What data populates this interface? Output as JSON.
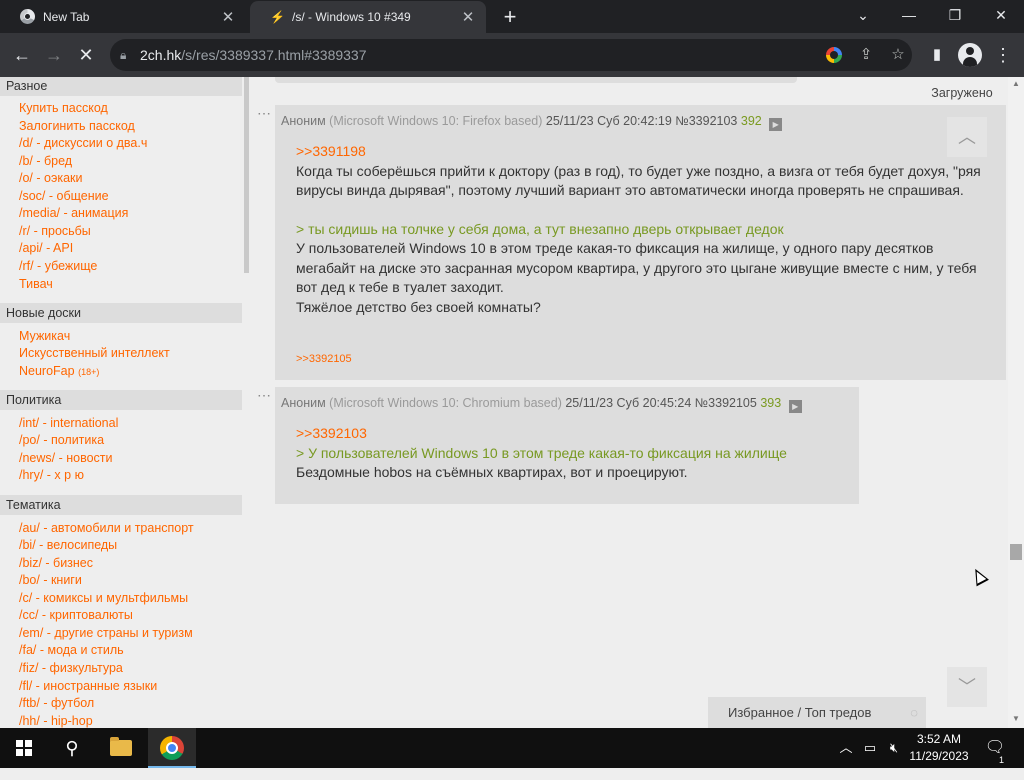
{
  "tabs": [
    {
      "title": "New Tab"
    },
    {
      "title": "/s/ - Windows 10 #349"
    }
  ],
  "address": {
    "host": "2ch.hk",
    "path": "/s/res/3389337.html#3389337"
  },
  "sidebar": {
    "sections": [
      {
        "title": "Разное",
        "links": [
          {
            "label": "Купить пасскод"
          },
          {
            "label": "Залогинить пасскод"
          },
          {
            "label": "/d/ - дискуссии о два.ч"
          },
          {
            "label": "/b/ - бред"
          },
          {
            "label": "/o/ - оэкаки"
          },
          {
            "label": "/soc/ - общение"
          },
          {
            "label": "/media/ - анимация"
          },
          {
            "label": "/r/ - просьбы"
          },
          {
            "label": "/api/ - API"
          },
          {
            "label": "/rf/ - убежище"
          },
          {
            "label": "Тивач"
          }
        ]
      },
      {
        "title": "Новые доски",
        "links": [
          {
            "label": "Мужикач"
          },
          {
            "label": "Искусственный интеллект"
          },
          {
            "label": "NeuroFap",
            "tag": "(18+)"
          }
        ]
      },
      {
        "title": "Политика",
        "links": [
          {
            "label": "/int/ - international"
          },
          {
            "label": "/po/ - политика"
          },
          {
            "label": "/news/ - новости"
          },
          {
            "label": "/hry/ - х р ю"
          }
        ]
      },
      {
        "title": "Тематика",
        "links": [
          {
            "label": "/au/ - автомобили и транспорт"
          },
          {
            "label": "/bi/ - велосипеды"
          },
          {
            "label": "/biz/ - бизнес"
          },
          {
            "label": "/bo/ - книги"
          },
          {
            "label": "/c/ - комиксы и мультфильмы"
          },
          {
            "label": "/cc/ - криптовалюты"
          },
          {
            "label": "/em/ - другие страны и туризм"
          },
          {
            "label": "/fa/ - мода и стиль"
          },
          {
            "label": "/fiz/ - физкультура"
          },
          {
            "label": "/fl/ - иностранные языки"
          },
          {
            "label": "/ftb/ - футбол"
          },
          {
            "label": "/hh/ - hip-hop"
          }
        ]
      }
    ]
  },
  "loaded_label": "Загружено",
  "posts": [
    {
      "name": "Аноним",
      "ua": "(Microsoft Windows 10: Firefox based)",
      "date": "25/11/23 Суб 20:42:19",
      "num": "№3392103",
      "count": "392",
      "reply": ">>3391198",
      "text1": "Когда ты соберёшься прийти к доктору (раз в год), то будет уже поздно, а визга от тебя будет дохуя, \"ряя вирусы винда дырявая\", поэтому лучший вариант это автоматически иногда проверять не спрашивая.",
      "quote": "> ты сидишь на толчке у себя дома, а тут внезапно дверь открывает дедок",
      "text2": "У пользователей Windows 10 в этом треде какая-то фиксация на жилище, у одного пару десятков мегабайт на диске это засранная мусором квартира, у другого это цыгане живущие вместе с ним, у тебя вот дед к тебе в туалет заходит.",
      "text3": "Тяжёлое детство без своей комнаты?",
      "answer": ">>3392105"
    },
    {
      "name": "Аноним",
      "ua": "(Microsoft Windows 10: Chromium based)",
      "date": "25/11/23 Суб 20:45:24",
      "num": "№3392105",
      "count": "393",
      "reply": ">>3392103",
      "quote": "> У пользователей Windows 10 в этом треде какая-то фиксация на жилище",
      "text1": "Бездомные hobos на съёмных квартирах, вот и проецируют."
    }
  ],
  "favorites_bar": {
    "label": "Избранное / Топ тредов"
  },
  "taskbar": {
    "time": "3:52 AM",
    "date": "11/29/2023",
    "notif_count": "1"
  }
}
